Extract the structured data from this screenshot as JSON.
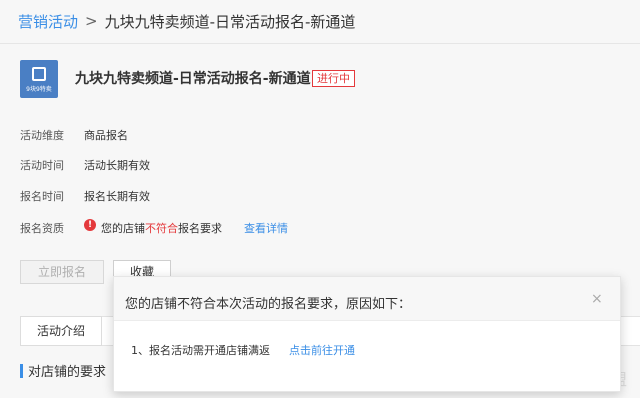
{
  "breadcrumb": {
    "root": "营销活动",
    "separator": ">",
    "current": "九块九特卖频道-日常活动报名-新通道"
  },
  "activity": {
    "logo_icon": "9-icon",
    "logo_text": "9块9特卖",
    "title": "九块九特卖频道-日常活动报名-新通道",
    "status": "进行中"
  },
  "info": [
    {
      "label": "活动维度",
      "value": "商品报名"
    },
    {
      "label": "活动时间",
      "value": "活动长期有效"
    },
    {
      "label": "报名时间",
      "value": "报名长期有效"
    }
  ],
  "qualification": {
    "label": "报名资质",
    "icon": "exclamation-icon",
    "prefix": "您的店铺",
    "highlight": "不符合",
    "suffix": "报名要求",
    "link": "查看详情"
  },
  "actions": {
    "signup": "立即报名",
    "favorite": "收藏"
  },
  "tabs": {
    "intro": "活动介绍"
  },
  "section": {
    "title": "对店铺的要求"
  },
  "corner_text": "盟",
  "modal": {
    "title": "您的店铺不符合本次活动的报名要求，原因如下：",
    "close": "×",
    "reason": "1、报名活动需开通店铺满返",
    "link": "点击前往开通"
  },
  "colors": {
    "accent": "#3a8ee6",
    "danger": "#e4393c"
  }
}
